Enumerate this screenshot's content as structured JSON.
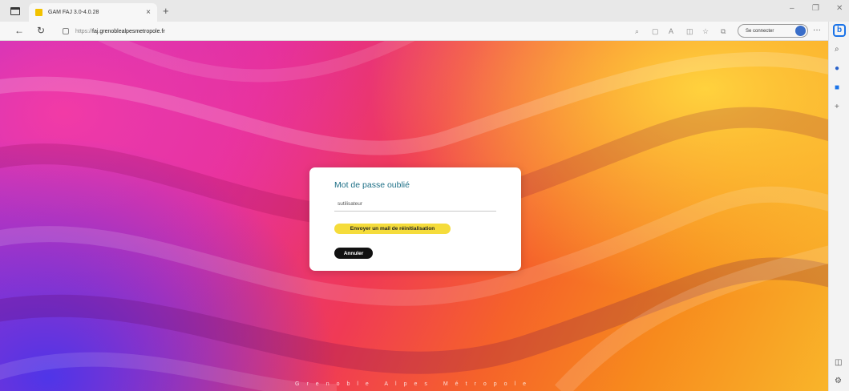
{
  "browser": {
    "tab": {
      "title": "GAM FAJ 3.0-4.0.28",
      "close": "×"
    },
    "new_tab": "+",
    "window_controls": {
      "minimize": "–",
      "restore": "❐",
      "close": "✕"
    },
    "nav": {
      "back": "←",
      "refresh": "↻"
    },
    "address": {
      "prefix": "https://",
      "host": "faj.grenoblealpesmetropole.fr"
    },
    "toolbar_icons": [
      "search-icon",
      "reader-view-icon",
      "read-aloud-icon",
      "split-screen-icon",
      "favorites-icon",
      "collections-icon"
    ],
    "signin_label": "Se connecter",
    "more": "···"
  },
  "sidebar": {
    "bing": "b",
    "icons": [
      "search-icon",
      "shopping-icon",
      "office-icon",
      "add-icon"
    ],
    "bottom_icons": [
      "sidebar-toggle-icon",
      "settings-icon"
    ]
  },
  "card": {
    "title": "Mot de passe oublié",
    "field_value": "sutilisateur",
    "send_label": "Envoyer un mail de réinitialisation",
    "cancel_label": "Annuler"
  },
  "footer": {
    "text": "Grenoble  Alpes  Métropole"
  },
  "colors": {
    "title": "#1d6f86",
    "send_button": "#f5dc3b",
    "cancel_button": "#111111"
  }
}
